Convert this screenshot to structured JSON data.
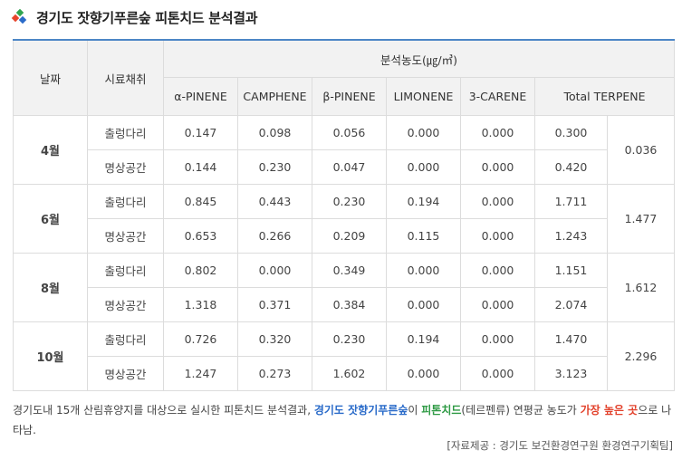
{
  "title": "경기도 잣향기푸른숲 피톤치드 분석결과",
  "colors": {
    "accent": "#4c86c6",
    "header_bg": "#f2f2f2",
    "highlight_blue": "#2a6bc9",
    "highlight_green": "#2e9a44",
    "highlight_red": "#e2402a"
  },
  "table": {
    "head": {
      "date": "날짜",
      "site": "시료채취",
      "group": "분석농도(㎍/㎥)",
      "columns": [
        "α-PINENE",
        "CAMPHENE",
        "β-PINENE",
        "LIMONENE",
        "3-CARENE",
        "Total TERPENE"
      ]
    },
    "groups": [
      {
        "month": "4월",
        "average": "0.036",
        "rows": [
          {
            "site": "출렁다리",
            "values": [
              "0.147",
              "0.098",
              "0.056",
              "0.000",
              "0.000",
              "0.300"
            ]
          },
          {
            "site": "명상공간",
            "values": [
              "0.144",
              "0.230",
              "0.047",
              "0.000",
              "0.000",
              "0.420"
            ]
          }
        ]
      },
      {
        "month": "6월",
        "average": "1.477",
        "rows": [
          {
            "site": "출렁다리",
            "values": [
              "0.845",
              "0.443",
              "0.230",
              "0.194",
              "0.000",
              "1.711"
            ]
          },
          {
            "site": "명상공간",
            "values": [
              "0.653",
              "0.266",
              "0.209",
              "0.115",
              "0.000",
              "1.243"
            ]
          }
        ]
      },
      {
        "month": "8월",
        "average": "1.612",
        "rows": [
          {
            "site": "출렁다리",
            "values": [
              "0.802",
              "0.000",
              "0.349",
              "0.000",
              "0.000",
              "1.151"
            ]
          },
          {
            "site": "명상공간",
            "values": [
              "1.318",
              "0.371",
              "0.384",
              "0.000",
              "0.000",
              "2.074"
            ]
          }
        ]
      },
      {
        "month": "10월",
        "average": "2.296",
        "rows": [
          {
            "site": "출렁다리",
            "values": [
              "0.726",
              "0.320",
              "0.230",
              "0.194",
              "0.000",
              "1.470"
            ]
          },
          {
            "site": "명상공간",
            "values": [
              "1.247",
              "0.273",
              "1.602",
              "0.000",
              "0.000",
              "3.123"
            ]
          }
        ]
      }
    ]
  },
  "footnote": {
    "part1": "경기도내 15개 산림휴양지를 대상으로 실시한 피톤치드 분석결과, ",
    "hl1": "경기도 잣향기푸른숲",
    "part2": "이 ",
    "hl2": "피톤치드",
    "part3": "(테르펜류) 연평균 농도가 ",
    "hl3": "가장 높은 곳",
    "part4": "으로 나타남."
  },
  "source": "[자료제공 : 경기도 보건환경연구원 환경연구기획팀]"
}
